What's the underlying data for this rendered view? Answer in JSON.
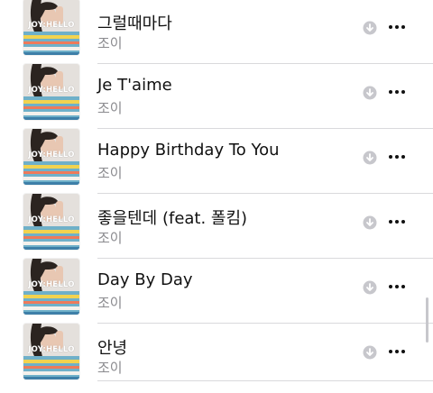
{
  "album_cover_text": "JOY:HELLO",
  "songs": [
    {
      "title": "그럴때마다",
      "artist": "조이"
    },
    {
      "title": "Je T'aime",
      "artist": "조이"
    },
    {
      "title": "Happy Birthday To You",
      "artist": "조이"
    },
    {
      "title": "좋을텐데 (feat. 폴킴)",
      "artist": "조이"
    },
    {
      "title": "Day By Day",
      "artist": "조이"
    },
    {
      "title": "안녕",
      "artist": "조이"
    }
  ],
  "icons": {
    "download": "download-circle-icon",
    "more": "ellipsis-more-icon"
  }
}
